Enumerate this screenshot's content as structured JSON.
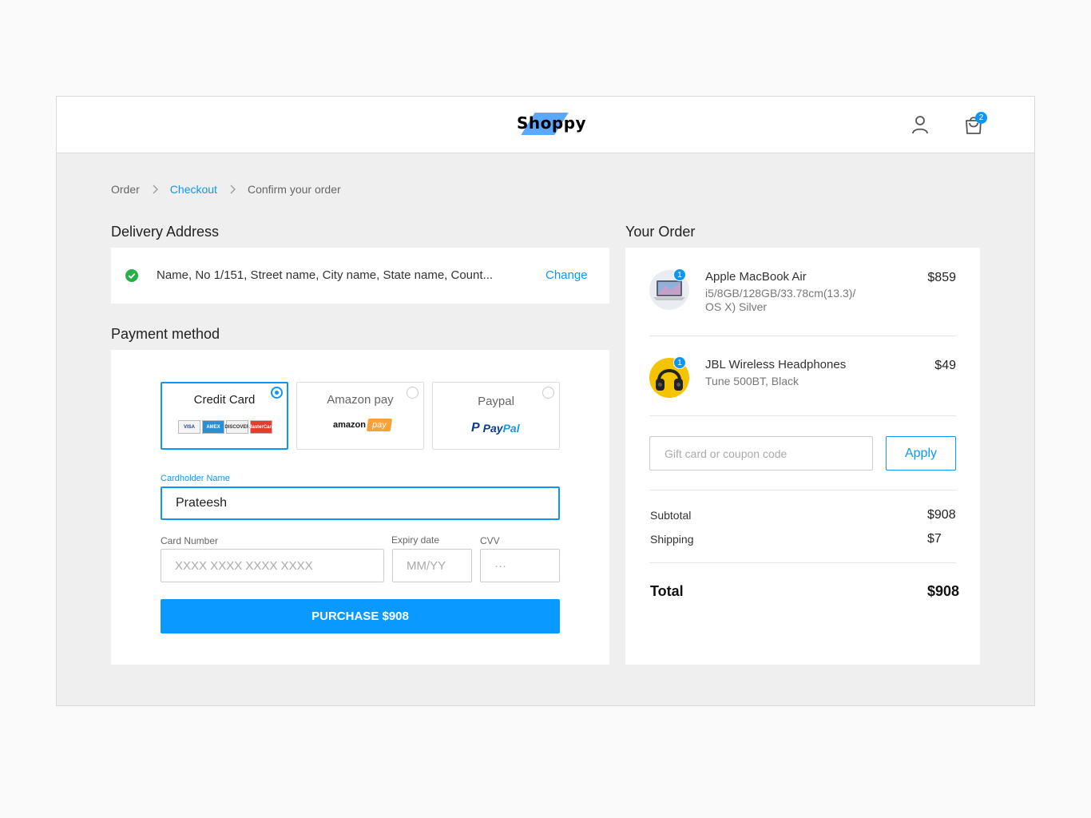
{
  "brand": {
    "name": "Shoppy",
    "accent": "#0f96f5"
  },
  "header": {
    "cart_count": "2"
  },
  "breadcrumb": [
    {
      "label": "Order"
    },
    {
      "label": "Checkout"
    },
    {
      "label": "Confirm your order"
    }
  ],
  "delivery": {
    "title": "Delivery Address",
    "address": "Name, No 1/151, Street name, City name, State name, Count...",
    "change_label": "Change"
  },
  "payment": {
    "title": "Payment method",
    "options": [
      {
        "label": "Credit Card",
        "selected": true,
        "cards": [
          "VISA",
          "AMEX",
          "DISCOVER",
          "MasterCard"
        ]
      },
      {
        "label": "Amazon pay",
        "selected": false,
        "logo_word": "amazon",
        "logo_badge": "pay"
      },
      {
        "label": "Paypal",
        "selected": false,
        "logo_a": "Pay",
        "logo_b": "Pal"
      }
    ],
    "cardholder_label": "Cardholder Name",
    "cardholder_value": "Prateesh",
    "card_number_label": "Card Number",
    "card_number_placeholder": "XXXX  XXXX  XXXX  XXXX",
    "expiry_label": "Expiry date",
    "expiry_placeholder": "MM/YY",
    "cvv_label": "CVV",
    "cvv_placeholder": "···",
    "purchase_label": "PURCHASE $908"
  },
  "order": {
    "title": "Your Order",
    "items": [
      {
        "name": "Apple MacBook Air",
        "desc_line1": "i5/8GB/128GB/33.78cm(13.3)/",
        "desc_line2": "OS X) Silver",
        "price": "$859",
        "qty": "1"
      },
      {
        "name": "JBL Wireless Headphones",
        "desc_line1": "Tune 500BT, Black",
        "desc_line2": "",
        "price": "$49",
        "qty": "1"
      }
    ],
    "coupon_placeholder": "Gift card or coupon code",
    "apply_label": "Apply",
    "subtotal_label": "Subtotal",
    "subtotal_value": "$908",
    "shipping_label": "Shipping",
    "shipping_value": "$7",
    "total_label": "Total",
    "total_value": "$908"
  }
}
